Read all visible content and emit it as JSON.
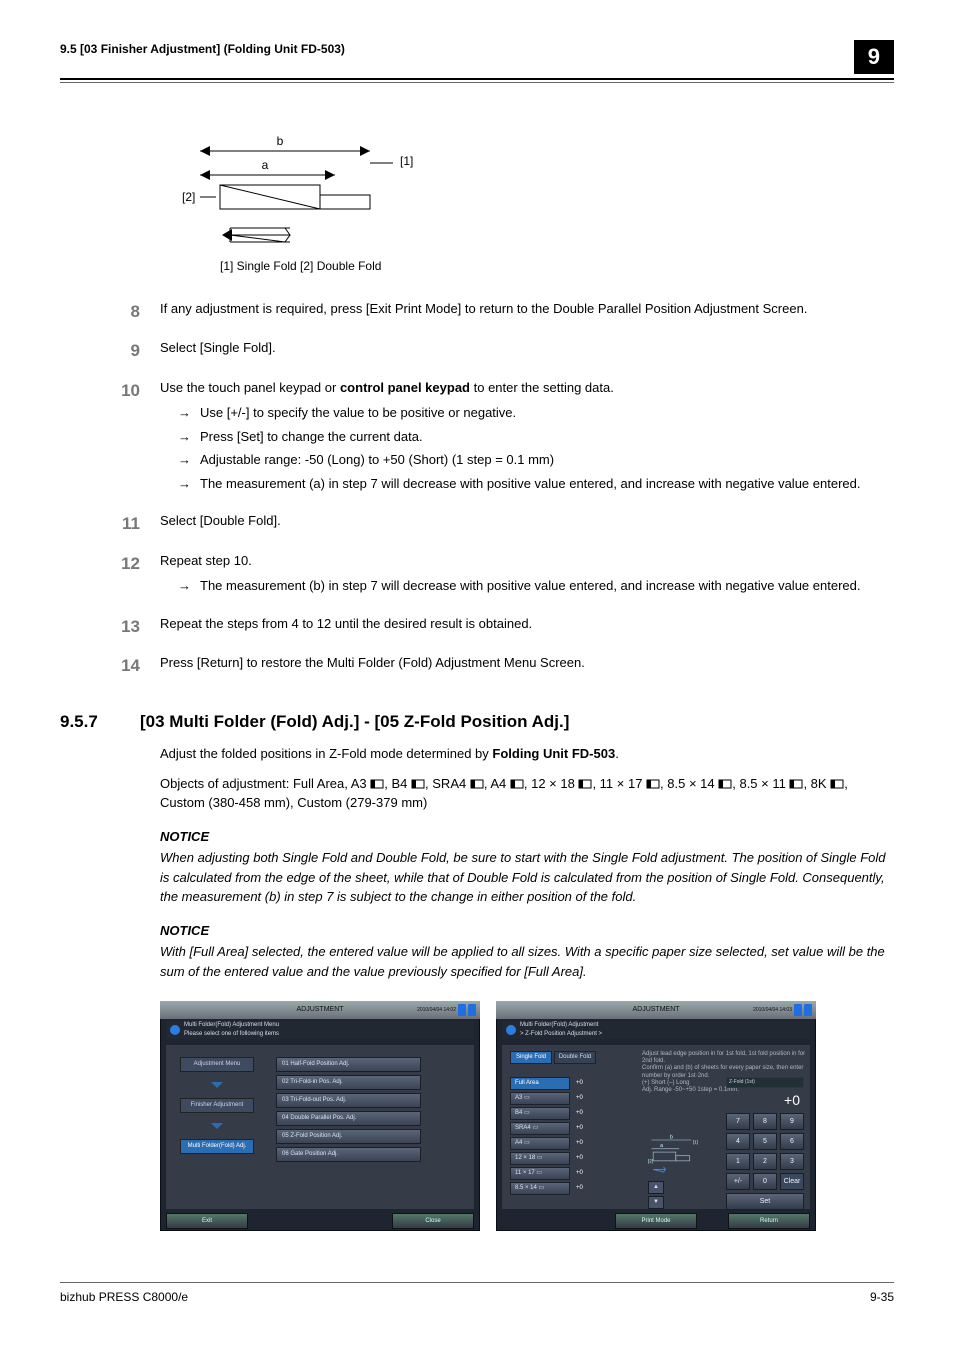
{
  "header": {
    "left": "9.5    [03 Finisher Adjustment] (Folding Unit FD-503)",
    "chapter": "9"
  },
  "diagram": {
    "caption": "[1] Single Fold [2] Double Fold",
    "a": "a",
    "b": "b",
    "ref1": "[1]",
    "ref2": "[2]"
  },
  "steps": {
    "s8": {
      "n": "8",
      "text": "If any adjustment is required, press [Exit Print Mode] to return to the Double Parallel Position Adjustment Screen."
    },
    "s9": {
      "n": "9",
      "text": "Select [Single Fold]."
    },
    "s10": {
      "n": "10",
      "text": "Use the touch panel keypad or control panel keypad to enter the setting data.",
      "bullets": [
        "Use [+/-] to specify the value to be positive or negative.",
        "Press [Set] to change the current data.",
        "Adjustable range: -50 (Long) to +50 (Short) (1 step = 0.1 mm)",
        "The measurement (a) in step 7 will decrease with positive value entered, and increase with negative value entered."
      ]
    },
    "s11": {
      "n": "11",
      "text": "Select [Double Fold]."
    },
    "s12": {
      "n": "12",
      "text": "Repeat step 10.",
      "bullets": [
        "The measurement (b) in step 7 will decrease with positive value entered, and increase with negative value entered."
      ]
    },
    "s13": {
      "n": "13",
      "text": "Repeat the steps from 4 to 12 until the desired result is obtained."
    },
    "s14": {
      "n": "14",
      "text": "Press [Return] to restore the Multi Folder (Fold) Adjustment Menu Screen."
    }
  },
  "section": {
    "num": "9.5.7",
    "title": "[03 Multi Folder (Fold) Adj.] - [05 Z-Fold Position Adj.]",
    "intro": "Adjust the folded positions in Z-Fold mode determined by Folding Unit FD-503.",
    "objects_pre": "Objects of adjustment: Full Area, A3 ",
    "objects_mid": ", B4 , SRA4 , A4 , 12 × 18 , 11 × 17 , 8.5 × 14 , 8.5 × 11 , 8K ",
    "objects_post": ", Custom (380-458 mm), Custom (279-379 mm)",
    "notice1_h": "NOTICE",
    "notice1": "When adjusting both Single Fold and Double Fold, be sure to start with the Single Fold adjustment. The position of Single Fold is calculated from the edge of the sheet, while that of Double Fold is calculated from the position of Single Fold. Consequently, the measurement (b) in step 7 is subject to the change in either position of the fold.",
    "notice2_h": "NOTICE",
    "notice2": "With [Full Area] selected, the entered value will be applied to all sizes. With a specific paper size selected, set value will be the sum of the entered value and the value previously specified for [Full Area]."
  },
  "panelL": {
    "top": "ADJUSTMENT",
    "date": "2010/04/04  14:02",
    "title": "Multi Folder(Fold) Adjustment Menu\nPlease select one of following items",
    "crumb1": "Adjustment Menu",
    "crumb2": "Finisher Adjustment",
    "crumb3": "Multi Folder(Fold) Adj.",
    "menu": [
      "01 Half-Fold Position Adj.",
      "02 Tri-Fold-in Pos. Adj.",
      "03 Tri-Fold-out Pos. Adj.",
      "04 Double Parallel Pos. Adj.",
      "05 Z-Fold Position Adj.",
      "06 Gate Position Adj."
    ],
    "exit": "Exit",
    "close": "Close"
  },
  "panelR": {
    "top": "ADJUSTMENT",
    "date": "2010/04/04  14:03",
    "title": "Multi Folder(Fold) Adjustment\n> Z-Fold Position Adjustment >",
    "tab1": "Single Fold",
    "tab2": "Double Fold",
    "sizes": [
      {
        "label": "Full Area",
        "v": "+0",
        "sel": true
      },
      {
        "label": "A3 ▭",
        "v": "+0"
      },
      {
        "label": "B4 ▭",
        "v": "+0"
      },
      {
        "label": "SRA4 ▭",
        "v": "+0"
      },
      {
        "label": "A4 ▭",
        "v": "+0"
      },
      {
        "label": "12 × 18 ▭",
        "v": "+0"
      },
      {
        "label": "11 × 17 ▭",
        "v": "+0"
      },
      {
        "label": "8.5 × 14 ▭",
        "v": "+0"
      }
    ],
    "instr": "Adjust lead edge position in for 1st fold, 1st fold position in for 2nd fold.\nConfirm (a) and (b) of sheets for every paper size, then enter number by order 1st·2nd.\n(+) Short  (–) Long\nAdj. Range  -50~+50  1step = 0.1mm.",
    "set_label": "Z-Fold (1st)",
    "set_value": "+0",
    "keys": [
      "7",
      "8",
      "9",
      "4",
      "5",
      "6",
      "1",
      "2",
      "3",
      "+/-",
      "0",
      "Clear"
    ],
    "set": "Set",
    "print": "Print Mode",
    "ret": "Return",
    "dia_a": "a",
    "dia_b": "b",
    "dia1": "[1]",
    "dia2": "[2]",
    "up": "▲",
    "dn": "▼"
  },
  "footer": {
    "left": "bizhub PRESS C8000/e",
    "right": "9-35"
  }
}
